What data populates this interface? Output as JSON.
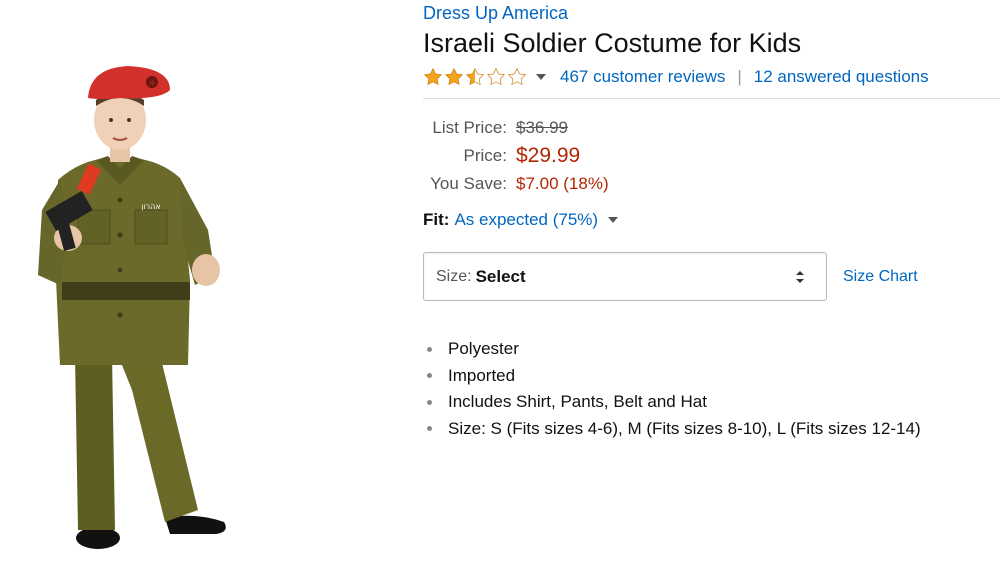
{
  "product": {
    "brand": "Dress Up America",
    "title": "Israeli Soldier Costume for Kids",
    "rating": {
      "stars": 2.5,
      "max_stars": 5,
      "reviews_label": "467 customer reviews",
      "separator": "|",
      "questions_label": "12 answered questions"
    },
    "price": {
      "list_label": "List Price:",
      "list_value": "$36.99",
      "price_label": "Price:",
      "price_value": "$29.99",
      "save_label": "You Save:",
      "save_value": "$7.00 (18%)"
    },
    "fit": {
      "label": "Fit:",
      "value": "As expected (75%)"
    },
    "size": {
      "label": "Size:",
      "selected": "Select",
      "chart_link": "Size Chart"
    },
    "bullets": [
      "Polyester",
      "Imported",
      "Includes Shirt, Pants, Belt and Hat",
      "Size: S (Fits sizes 4-6), M (Fits sizes 8-10), L (Fits sizes 12-14)"
    ],
    "image": {
      "beret_text": "☼",
      "name_tag": "אהרון"
    }
  },
  "colors": {
    "link": "#0066c0",
    "price": "#b12704",
    "star": "#f4a41c",
    "uniform": "#6b6a2a",
    "beret": "#d2312b"
  }
}
